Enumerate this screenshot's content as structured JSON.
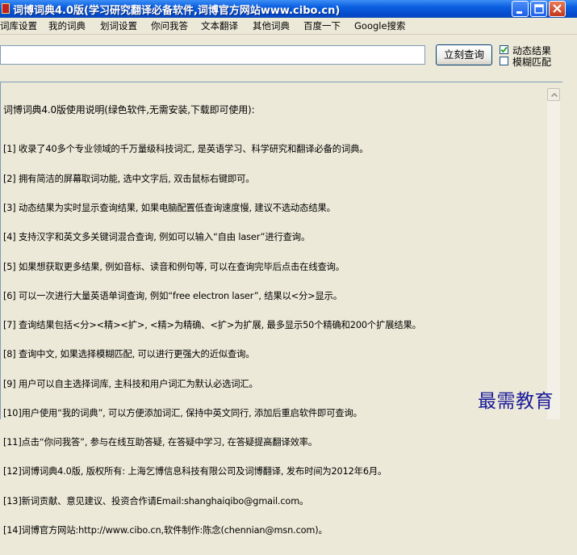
{
  "window": {
    "title": "词博词典4.0版(学习研究翻译必备软件,词博官方网站www.cibo.cn)",
    "minimize_icon": "minimize-icon",
    "maximize_icon": "maximize-icon",
    "close_icon": "close-icon"
  },
  "menu": {
    "items": [
      {
        "label": "词库设置"
      },
      {
        "label": "我的词典"
      },
      {
        "label": "划词设置"
      },
      {
        "label": "你问我答"
      },
      {
        "label": "文本翻译"
      },
      {
        "label": "其他词典"
      },
      {
        "label": "百度一下"
      },
      {
        "label": "Google搜索"
      }
    ]
  },
  "search": {
    "value": "",
    "button_label": "立刻查询",
    "options": [
      {
        "label": "动态结果",
        "checked": true
      },
      {
        "label": "模糊匹配",
        "checked": false
      }
    ]
  },
  "content": {
    "heading": "词博词典4.0版使用说明(绿色软件,无需安装,下载即可使用):",
    "lines": [
      "[1] 收录了40多个专业领域的千万量级科技词汇, 是英语学习、科学研究和翻译必备的词典。",
      "[2] 拥有简洁的屏幕取词功能, 选中文字后, 双击鼠标右键即可。",
      "[3] 动态结果为实时显示查询结果, 如果电脑配置低查询速度慢, 建议不选动态结果。",
      "[4] 支持汉字和英文多关键词混合查询, 例如可以输入“自由 laser”进行查询。",
      "[5] 如果想获取更多结果, 例如音标、读音和例句等, 可以在查询完毕后点击在线查询。",
      "[6] 可以一次进行大量英语单词查询, 例如“free electron laser”, 结果以<分>显示。",
      "[7] 查询结果包括<分><精><扩>, <精>为精确、<扩>为扩展, 最多显示50个精确和200个扩展结果。",
      "[8] 查询中文, 如果选择模糊匹配, 可以进行更强大的近似查询。",
      "[9] 用户可以自主选择词库, 主科技和用户词汇为默认必选词汇。",
      "[10]用户使用“我的词典”, 可以方便添加词汇, 保持中英文同行, 添加后重启软件即可查询。",
      "[11]点击“你问我答”, 参与在线互助答疑, 在答疑中学习, 在答疑提高翻译效率。",
      "[12]词博词典4.0版, 版权所有: 上海乞博信息科技有限公司及词博翻译, 发布时间为2012年6月。",
      "[13]新词贡献、意见建议、投资合作请Email:shanghaiqibo@gmail.com。",
      "[14]词博官方网站:http://www.cibo.cn,软件制作:陈念(chennian@msn.com)。"
    ]
  },
  "scroll_up_icon": "scroll-up-arrow-icon",
  "watermark": "最需教育"
}
